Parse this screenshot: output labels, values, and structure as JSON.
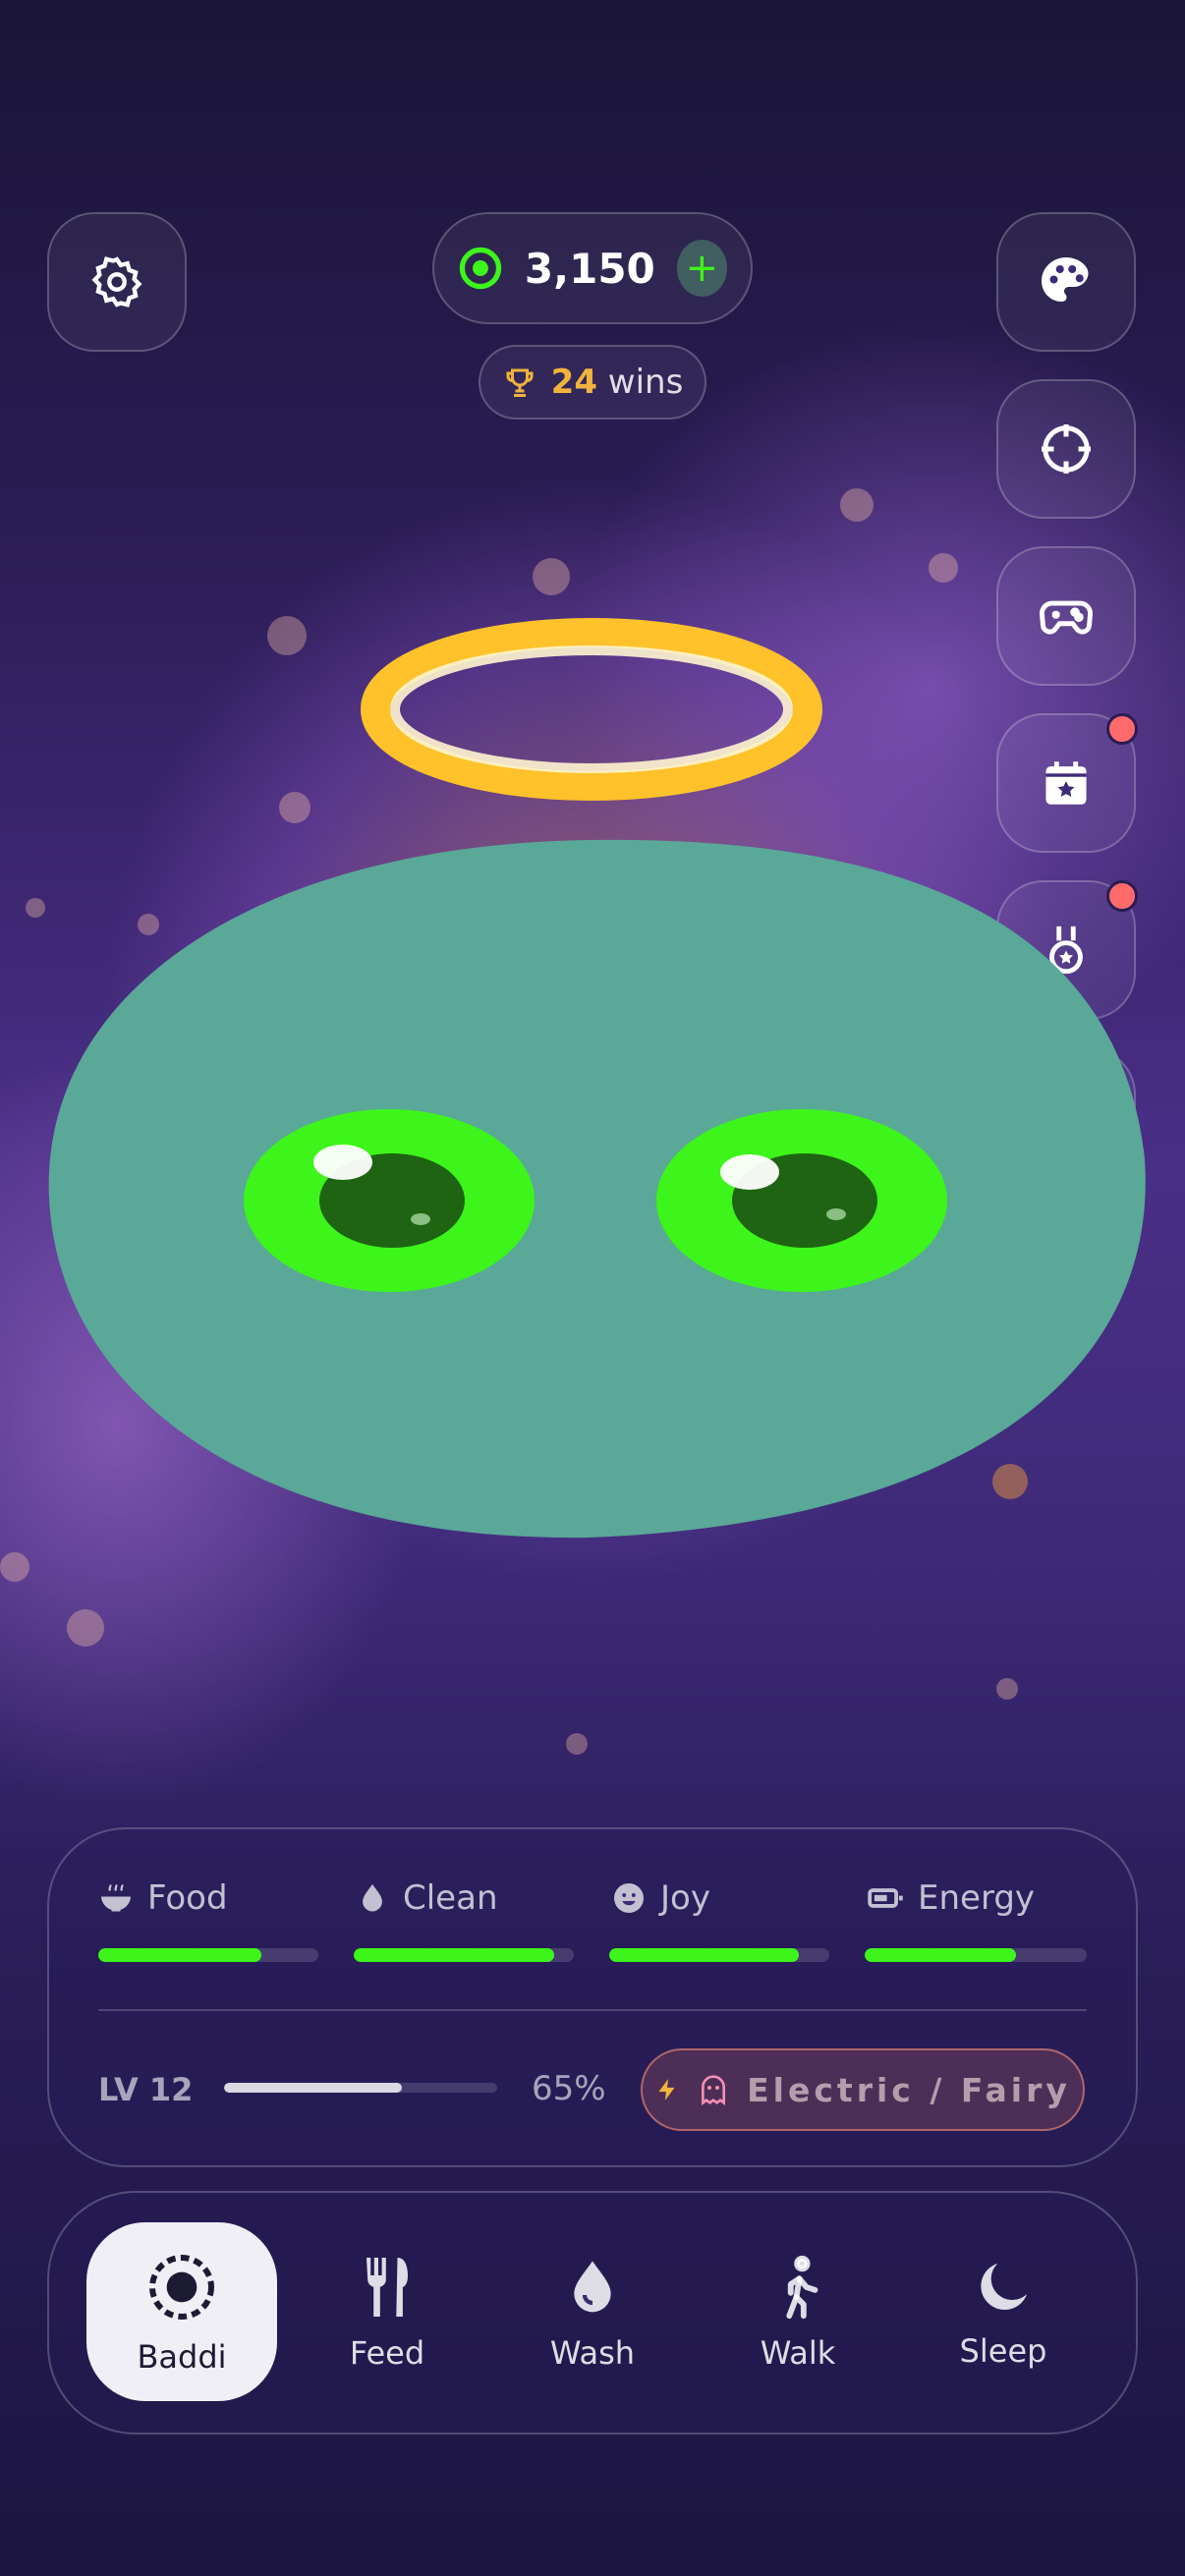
{
  "header": {
    "coins": "3,150",
    "coin_plus": "+",
    "wins_count": "24",
    "wins_label": "wins"
  },
  "side_buttons": [
    {
      "icon": "palette-icon",
      "badge": false
    },
    {
      "icon": "crosshair-icon",
      "badge": false
    },
    {
      "icon": "gamepad-icon",
      "badge": false
    },
    {
      "icon": "calendar-star-icon",
      "badge": true
    },
    {
      "icon": "medal-icon",
      "badge": true
    },
    {
      "icon": "book-icon",
      "badge": false
    }
  ],
  "stats": {
    "food": {
      "label": "Food",
      "level": 0.74
    },
    "clean": {
      "label": "Clean",
      "level": 0.91
    },
    "joy": {
      "label": "Joy",
      "level": 0.86
    },
    "energy": {
      "label": "Energy",
      "level": 0.68
    }
  },
  "level": {
    "label": "LV 12",
    "progress": 0.65,
    "percent_text": "65%",
    "type_text": "Electric / Fairy"
  },
  "nav": {
    "items": [
      {
        "label": "Baddi",
        "icon": "pet-icon",
        "active": true
      },
      {
        "label": "Feed",
        "icon": "fork-knife-icon",
        "active": false
      },
      {
        "label": "Wash",
        "icon": "drop-icon",
        "active": false
      },
      {
        "label": "Walk",
        "icon": "walk-icon",
        "active": false
      },
      {
        "label": "Sleep",
        "icon": "moon-icon",
        "active": false
      }
    ]
  },
  "colors": {
    "accent_green": "#3df51a",
    "pet_body": "#5aa898",
    "halo": "#ffc22a",
    "wins_gold": "#f0b43c",
    "badge_red": "#ff6a6a"
  }
}
